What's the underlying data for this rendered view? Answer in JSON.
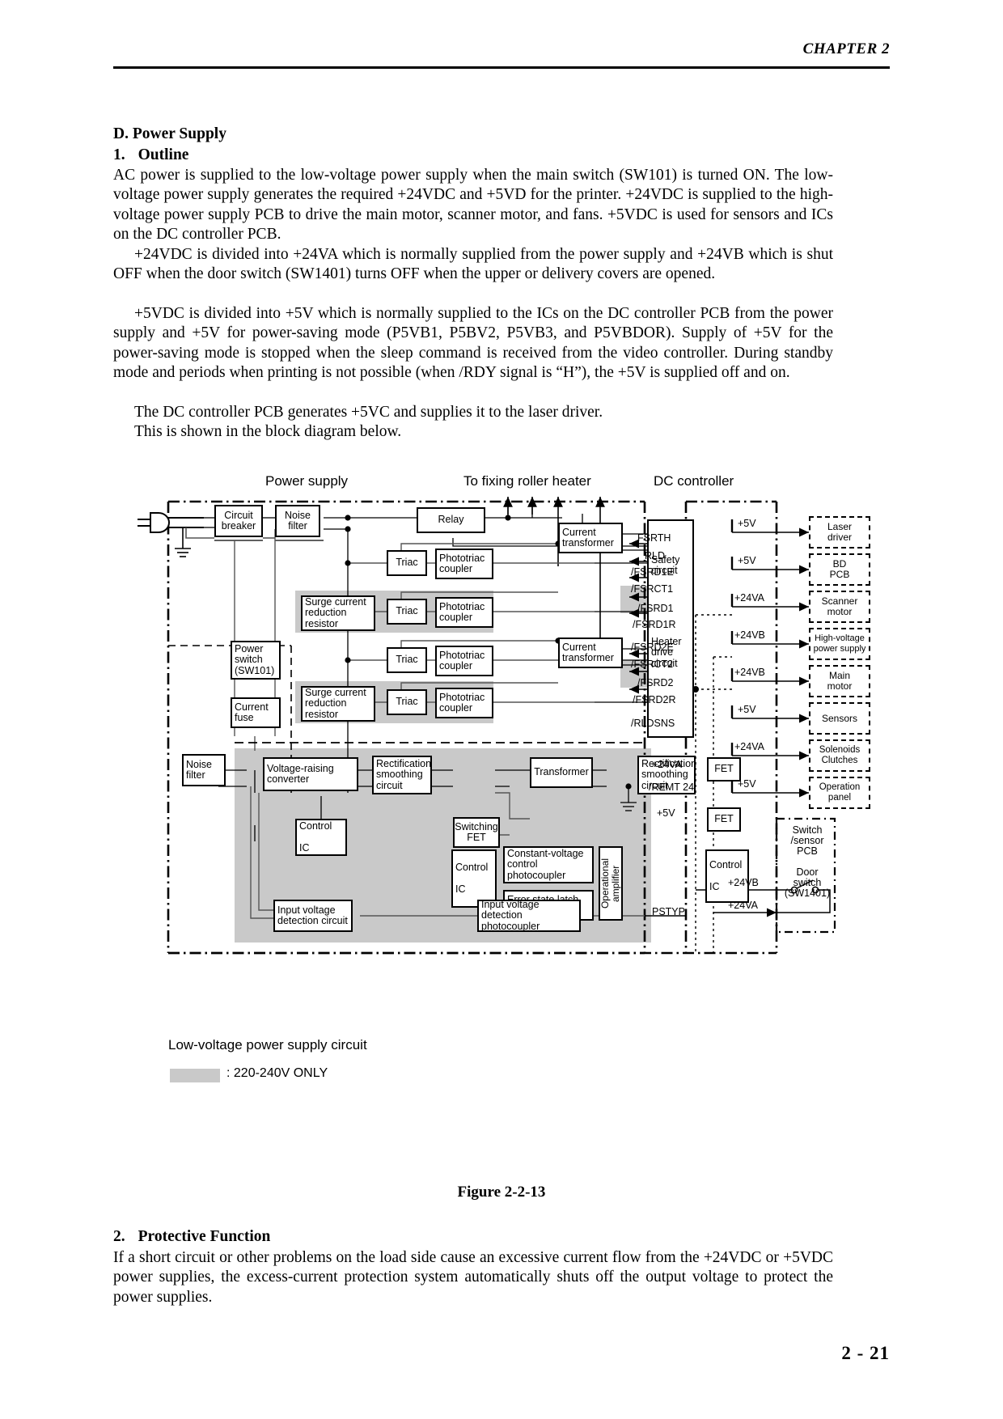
{
  "header": {
    "chapter": "CHAPTER 2"
  },
  "page_number": "2 - 21",
  "sections": {
    "d_title": "D.  Power Supply",
    "outline_num": "1.",
    "outline_title": "Outline",
    "p1": "AC power is supplied to the low-voltage power supply when the main switch (SW101) is turned ON.  The low-voltage power supply generates the required +24VDC and +5VD for the printer. +24VDC is supplied to the high-voltage power supply PCB to drive the main motor, scanner motor, and fans.  +5VDC is used for sensors and ICs on the DC controller PCB.",
    "p2": "+24VDC is divided into +24VA which is normally supplied from the power supply and +24VB which is shut OFF when the door switch (SW1401) turns OFF when the upper or delivery covers are opened.",
    "p3": "+5VDC is divided into +5V which is normally supplied to the ICs on the DC controller PCB from the power supply and +5V for power-saving mode (P5VB1, P5BV2, P5VB3, and P5VBDOR).  Supply of +5V for the power-saving mode is stopped when the sleep command is received from the video controller.   During standby mode and periods when printing is not possible (when /RDY signal is “H”), the +5V is supplied off and on.",
    "p4": "The DC controller PCB generates +5VC and supplies it to the laser driver.",
    "p5": "This is shown in the block diagram below.",
    "figure_caption": "Figure 2-2-13",
    "protective_num": "2.",
    "protective_title": "Protective Function",
    "p6": "If a short circuit or other problems on the load side cause an excessive current flow from the +24VDC or +5VDC power supplies, the excess-current protection system automatically shuts off the output voltage to protect the power supplies."
  },
  "diagram": {
    "titles": {
      "power_supply": "Power supply",
      "fixing_heater": "To fixing roller heater",
      "dc_controller": "DC controller",
      "lvps": "Low-voltage power supply circuit"
    },
    "legend": {
      "text": ": 220-240V ONLY",
      "swatch_color": "#c9c9c9"
    },
    "blocks": {
      "circuit_breaker": "Circuit\nbreaker",
      "noise_filter_top": "Noise\nfilter",
      "relay": "Relay",
      "triac": "Triac",
      "phototriac_coupler": "Phototriac\ncoupler",
      "surge_resistor": "Surge current\nreduction\nresistor",
      "power_switch": "Power\nswitch\n(SW101)",
      "current_fuse": "Current\nfuse",
      "noise_filter_bottom": "Noise\nfilter",
      "current_transformer": "Current\ntransformer",
      "safety_circuit": "Safety\ncircuit",
      "heater_drive_circuit": "Heater\ndrive\ncircuit",
      "voltage_raising_converter": "Voltage-raising\nconverter",
      "control_ic": "Control\n\nIC",
      "rectification_smoothing": "Rectification\nsmoothing\ncircuit",
      "transformer": "Transformer",
      "switching_fet": "Switching\nFET",
      "constant_voltage_photocoupler": "Constant-voltage\ncontrol\nphotocoupler",
      "error_state_latch_photocoupler": "Error state latch\nphotocoupler",
      "operational_amplifier": "Operational\namplifier",
      "fet": "FET",
      "input_voltage_detection_circuit": "Input voltage\ndetection circuit",
      "input_voltage_detection_photocoupler": "Input voltage detection\nphotocoupler"
    },
    "signals": [
      {
        "name": "FSRTH",
        "direction": "to-safety",
        "shaded": false
      },
      {
        "name": "RLD",
        "direction": "to-safety",
        "shaded": false
      },
      {
        "name": "/FSRD1E",
        "direction": "to-safety",
        "shaded": false
      },
      {
        "name": "/FSRCT1",
        "direction": "to-controller",
        "shaded": false
      },
      {
        "name": "/FSRD1",
        "direction": "to-safety",
        "shaded": true
      },
      {
        "name": "/FSRD1R",
        "direction": "to-safety",
        "shaded": true
      },
      {
        "name": "/FSRD2E",
        "direction": "to-heater",
        "shaded": false
      },
      {
        "name": "/FSRCT2",
        "direction": "to-controller",
        "shaded": false
      },
      {
        "name": "/FSRD2",
        "direction": "to-heater",
        "shaded": true
      },
      {
        "name": "/FSRD2R",
        "direction": "to-heater",
        "shaded": true
      },
      {
        "name": "/RLDSNS",
        "direction": "to-controller",
        "shaded": false
      }
    ],
    "supply_rails": [
      {
        "label": "+24VA",
        "target": "Solenoids\nClutches"
      },
      {
        "label": "/REMT 24",
        "target": ""
      },
      {
        "label": "+5V",
        "target": ""
      },
      {
        "label": "PSTYP",
        "target": ""
      },
      {
        "label": "+24VB",
        "target": ""
      },
      {
        "label": "+24VA",
        "target": ""
      }
    ],
    "loads": [
      {
        "rail": "+5V",
        "label": "Laser\ndriver"
      },
      {
        "rail": "+5V",
        "label": "BD\nPCB"
      },
      {
        "rail": "+24VA",
        "label": "Scanner\nmotor"
      },
      {
        "rail": "+24VB",
        "label": "High-voltage\npower supply"
      },
      {
        "rail": "+24VB",
        "label": "Main\nmotor"
      },
      {
        "rail": "+5V",
        "label": "Sensors"
      },
      {
        "rail": "+24VA",
        "label": "Solenoids\nClutches"
      },
      {
        "rail": "+5V",
        "label": "Operation\npanel"
      }
    ],
    "switch_pcb": {
      "title": "Switch\n/sensor\nPCB",
      "door_switch": "Door\nswitch\n(SW1401)",
      "in_rail": "+24VB",
      "out_rail": "+24VA"
    }
  }
}
